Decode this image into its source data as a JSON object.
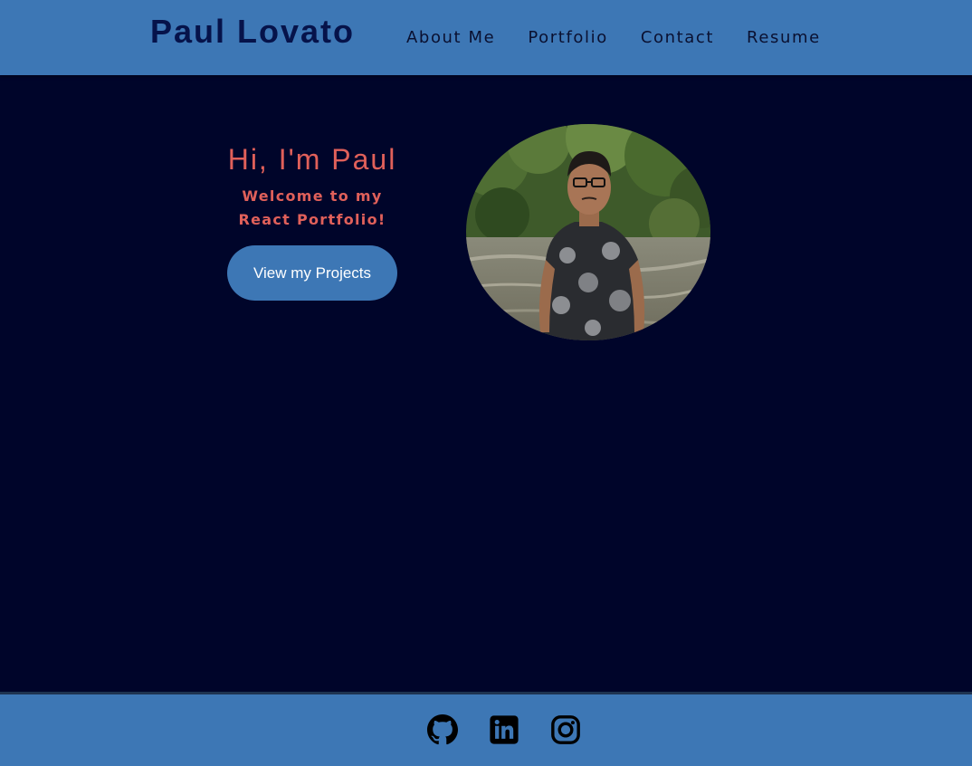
{
  "header": {
    "brand": "Paul Lovato",
    "nav": [
      {
        "label": "About Me"
      },
      {
        "label": "Portfolio"
      },
      {
        "label": "Contact"
      },
      {
        "label": "Resume"
      }
    ]
  },
  "hero": {
    "greeting": "Hi, I'm Paul",
    "subtitle_line1": "Welcome to my",
    "subtitle_line2": "React Portfolio!",
    "cta_label": "View my Projects",
    "photo_alt": "photo"
  },
  "footer": {
    "social": [
      {
        "icon": "github-icon"
      },
      {
        "icon": "linkedin-icon"
      },
      {
        "icon": "instagram-icon"
      }
    ]
  },
  "colors": {
    "header_bg": "#3d77b5",
    "page_bg": "#00052a",
    "accent_text": "#e0605a",
    "brand_text": "#06134a"
  }
}
